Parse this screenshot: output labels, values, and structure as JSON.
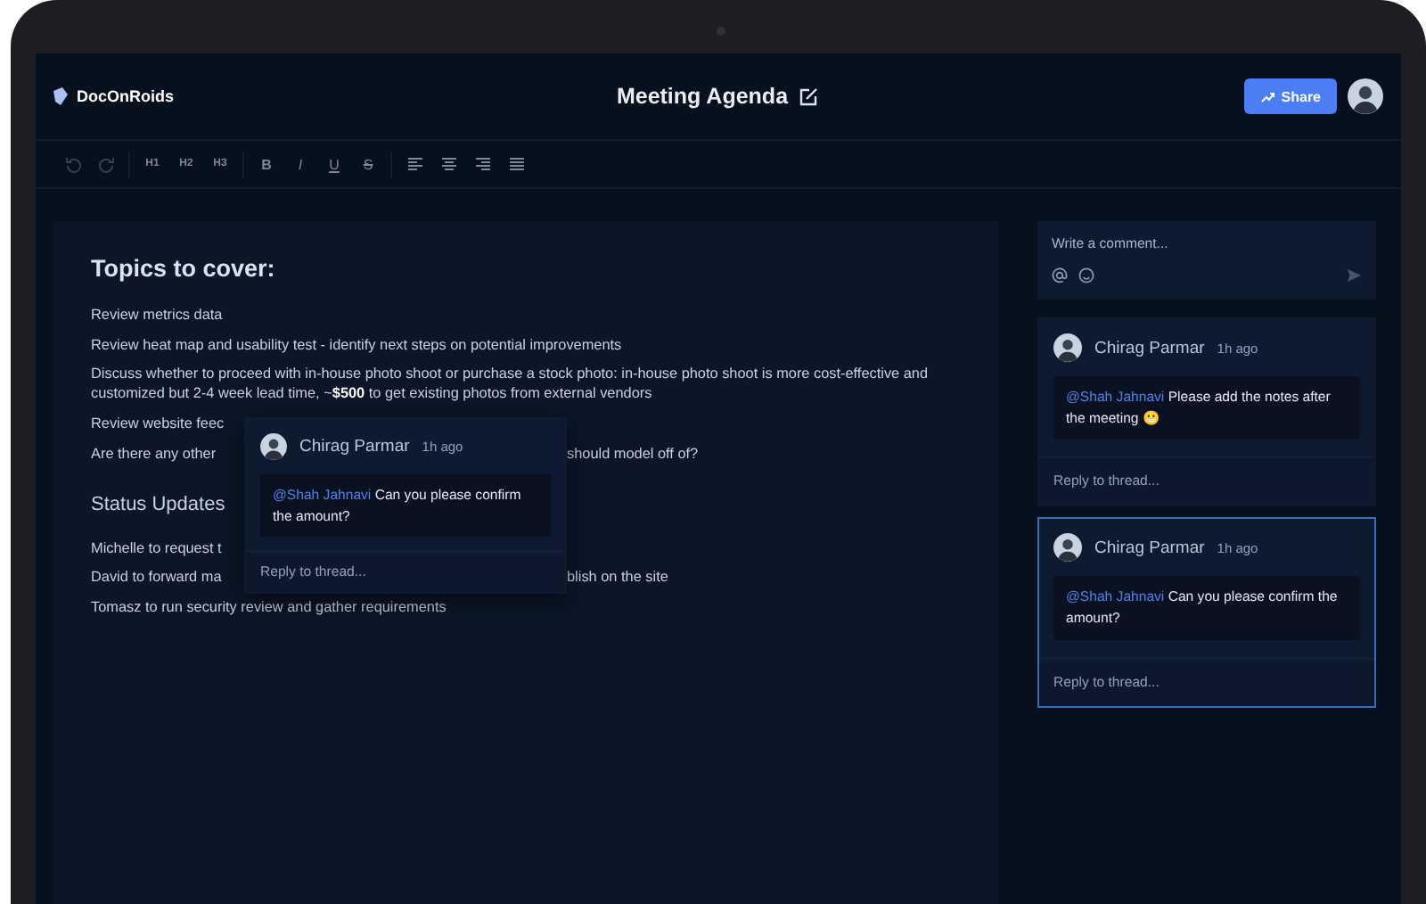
{
  "header": {
    "logo": "DocOnRoids",
    "title": "Meeting Agenda",
    "share_label": "Share"
  },
  "toolbar": {
    "groups": [
      [
        {
          "kind": "undo"
        },
        {
          "kind": "redo"
        }
      ],
      [
        {
          "kind": "heading",
          "label": "H1"
        },
        {
          "kind": "heading",
          "label": "H2"
        },
        {
          "kind": "heading",
          "label": "H3"
        }
      ],
      [
        {
          "kind": "bold",
          "label": "B"
        },
        {
          "kind": "italic",
          "label": "I"
        },
        {
          "kind": "underline",
          "label": "U"
        },
        {
          "kind": "strike",
          "label": "S"
        }
      ],
      [
        {
          "kind": "align-left"
        },
        {
          "kind": "align-center"
        },
        {
          "kind": "align-right"
        },
        {
          "kind": "justify"
        }
      ]
    ]
  },
  "document": {
    "sections": [
      {
        "heading": "Topics to cover:",
        "kind": "title",
        "lines": [
          {
            "text": "Review metrics data"
          },
          {
            "text": "Review heat map and usability test - identify next steps on potential improvements"
          },
          {
            "text": "Discuss whether to proceed with in-house photo shoot or purchase a stock photo: in-house photo shoot is more cost-effective and customized but 2-4 week lead time, ~**$500** to get existing photos from external vendors"
          },
          {
            "text": "Review website feec"
          },
          {
            "text": "Are there any other",
            "tail": "should model off of?"
          }
        ]
      },
      {
        "heading": "Status Updates",
        "kind": "subtitle",
        "lines": [
          {
            "text": "Michelle to request t"
          },
          {
            "text": "David to forward ma",
            "tail": "blish on the site"
          },
          {
            "text": "Tomasz to run security review and gather requirements"
          }
        ]
      }
    ]
  },
  "popup": {
    "author": "Chirag Parmar",
    "time": "1h ago",
    "mention": "@Shah Jahnavi",
    "message": "Can you please confirm the amount?",
    "reply_placeholder": "Reply to thread..."
  },
  "composer": {
    "placeholder": "Write a comment..."
  },
  "threads": [
    {
      "author": "Chirag Parmar",
      "time": "1h ago",
      "mention": "@Shah Jahnavi",
      "message": "Please add the notes after the meeting 😬",
      "reply_placeholder": "Reply to thread...",
      "selected": false
    },
    {
      "author": "Chirag Parmar",
      "time": "1h ago",
      "mention": "@Shah Jahnavi",
      "message": "Can you please confirm the amount?",
      "reply_placeholder": "Reply to thread...",
      "selected": true
    }
  ]
}
